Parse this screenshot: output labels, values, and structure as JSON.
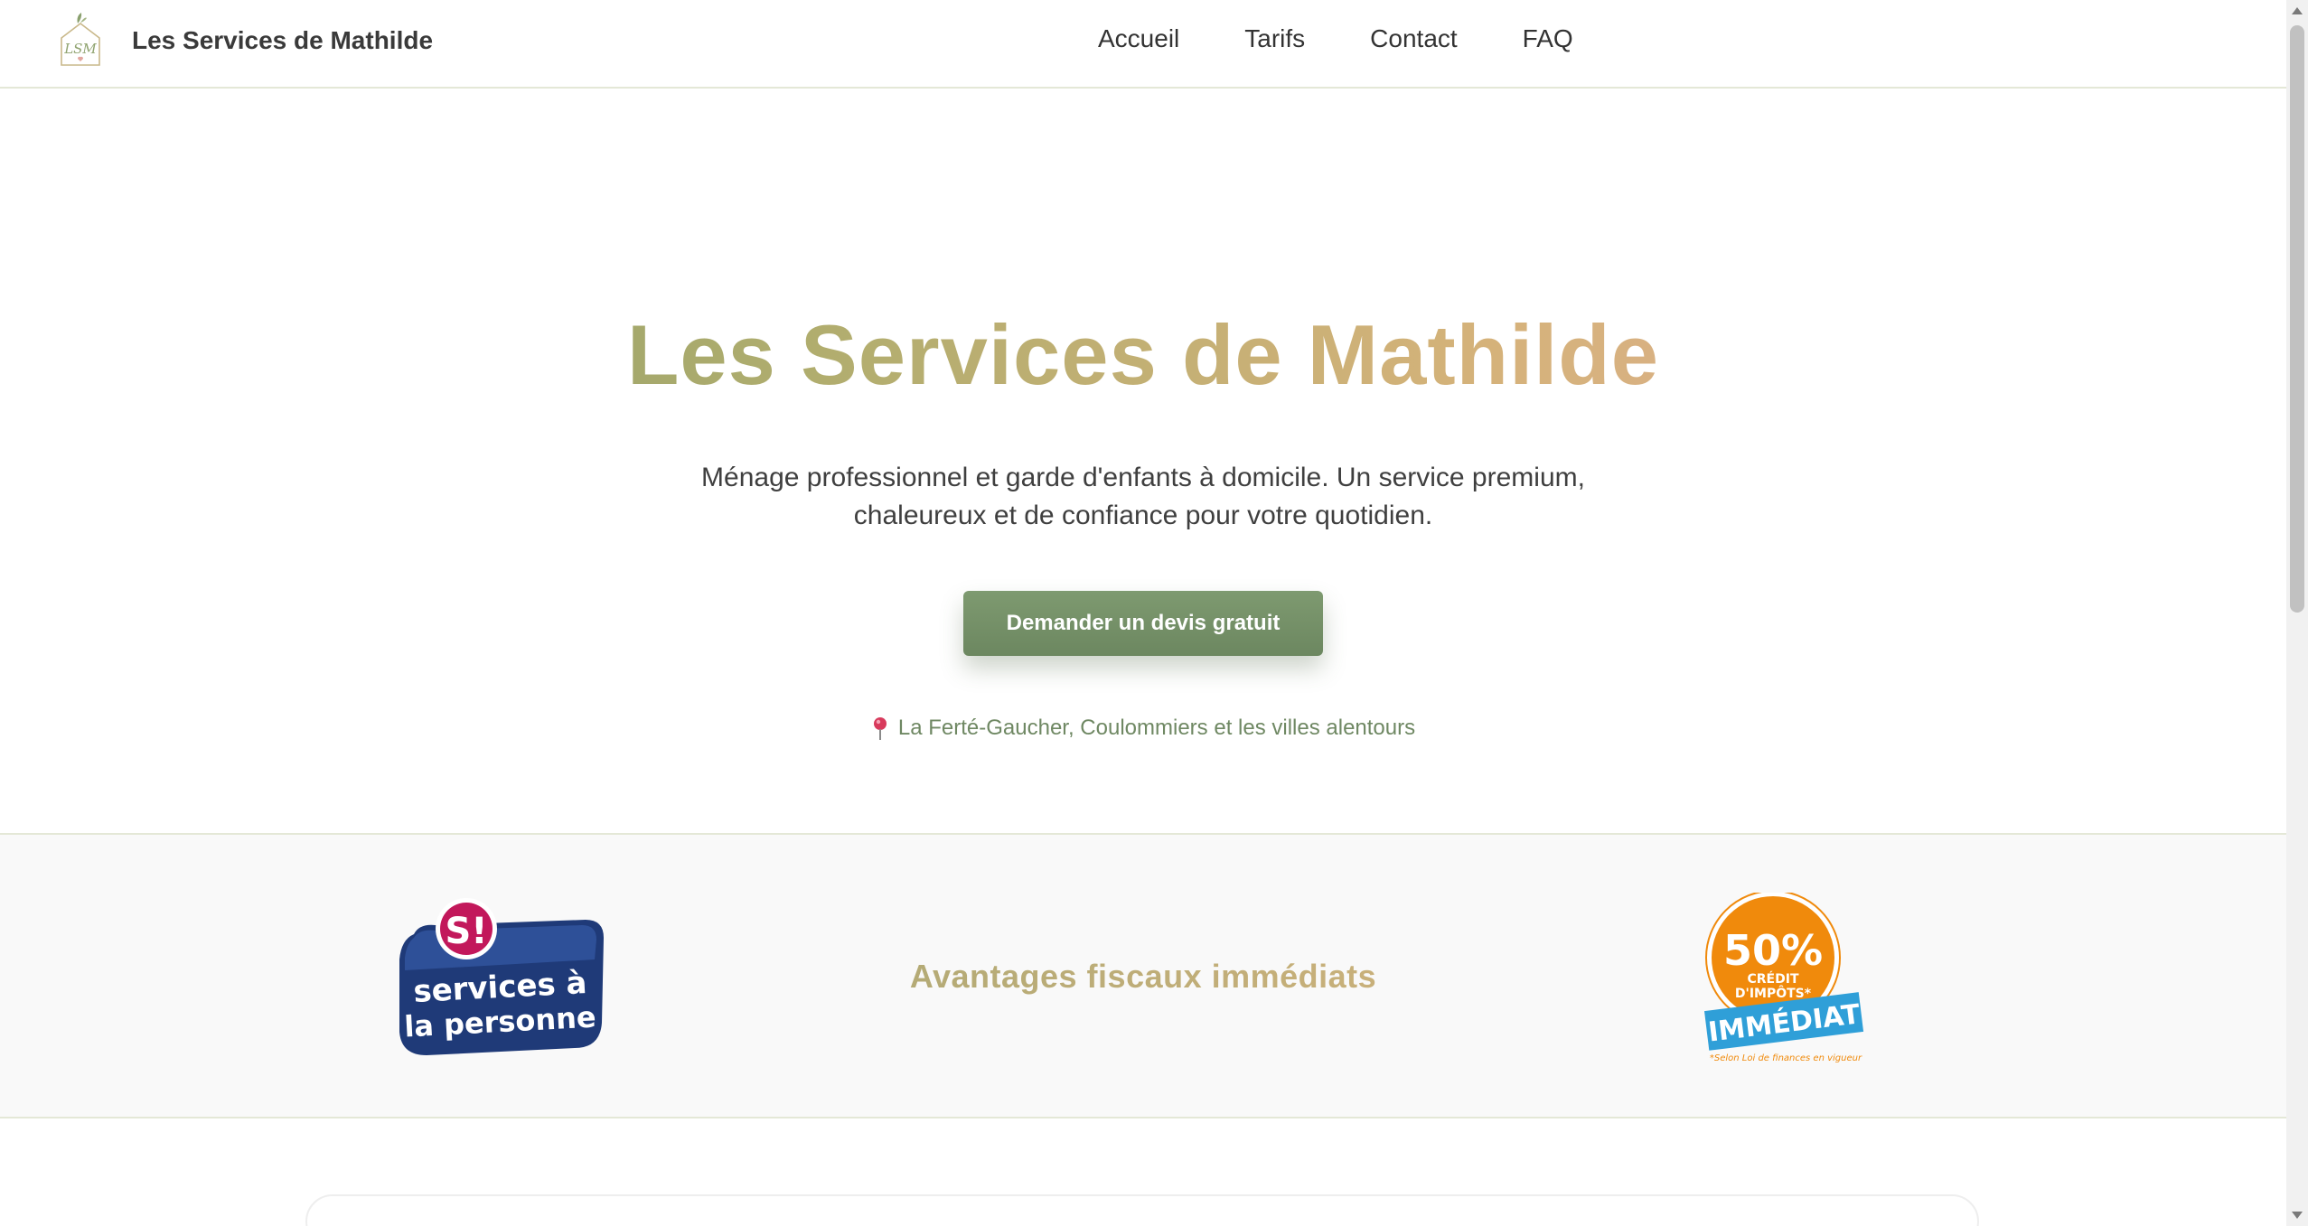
{
  "header": {
    "brand_name": "Les Services de Mathilde",
    "logo_letters": "LSM",
    "nav": [
      {
        "label": "Accueil"
      },
      {
        "label": "Tarifs"
      },
      {
        "label": "Contact"
      },
      {
        "label": "FAQ"
      }
    ]
  },
  "hero": {
    "title": "Les Services de Mathilde",
    "subtitle": "Ménage professionnel et garde d'enfants à domicile. Un service premium, chaleureux et de confiance pour votre quotidien.",
    "cta_label": "Demander un devis gratuit",
    "location_text": "La Ferté-Gaucher, Coulommiers et les villes alentours",
    "location_icon": "map-pin-icon"
  },
  "band": {
    "title": "Avantages fiscaux immédiats",
    "sap_logo": {
      "badge": "S!",
      "line1": "services à",
      "line2": "la personne"
    },
    "tax_badge": {
      "percent": "50%",
      "line1": "CRÉDIT",
      "line2": "D'IMPÔTS*",
      "ribbon": "IMMÉDIAT",
      "footnote": "*Selon Loi de finances en vigueur"
    }
  },
  "colors": {
    "accent_green": "#6c8760",
    "title_gradient_start": "#7f9867",
    "title_gradient_end": "#e2ae9e",
    "pin_red": "#d83a5c",
    "tax_orange": "#f08a0c",
    "tax_blue": "#2f9fd8",
    "sap_navy": "#1f3a78",
    "sap_magenta": "#c2185b"
  }
}
